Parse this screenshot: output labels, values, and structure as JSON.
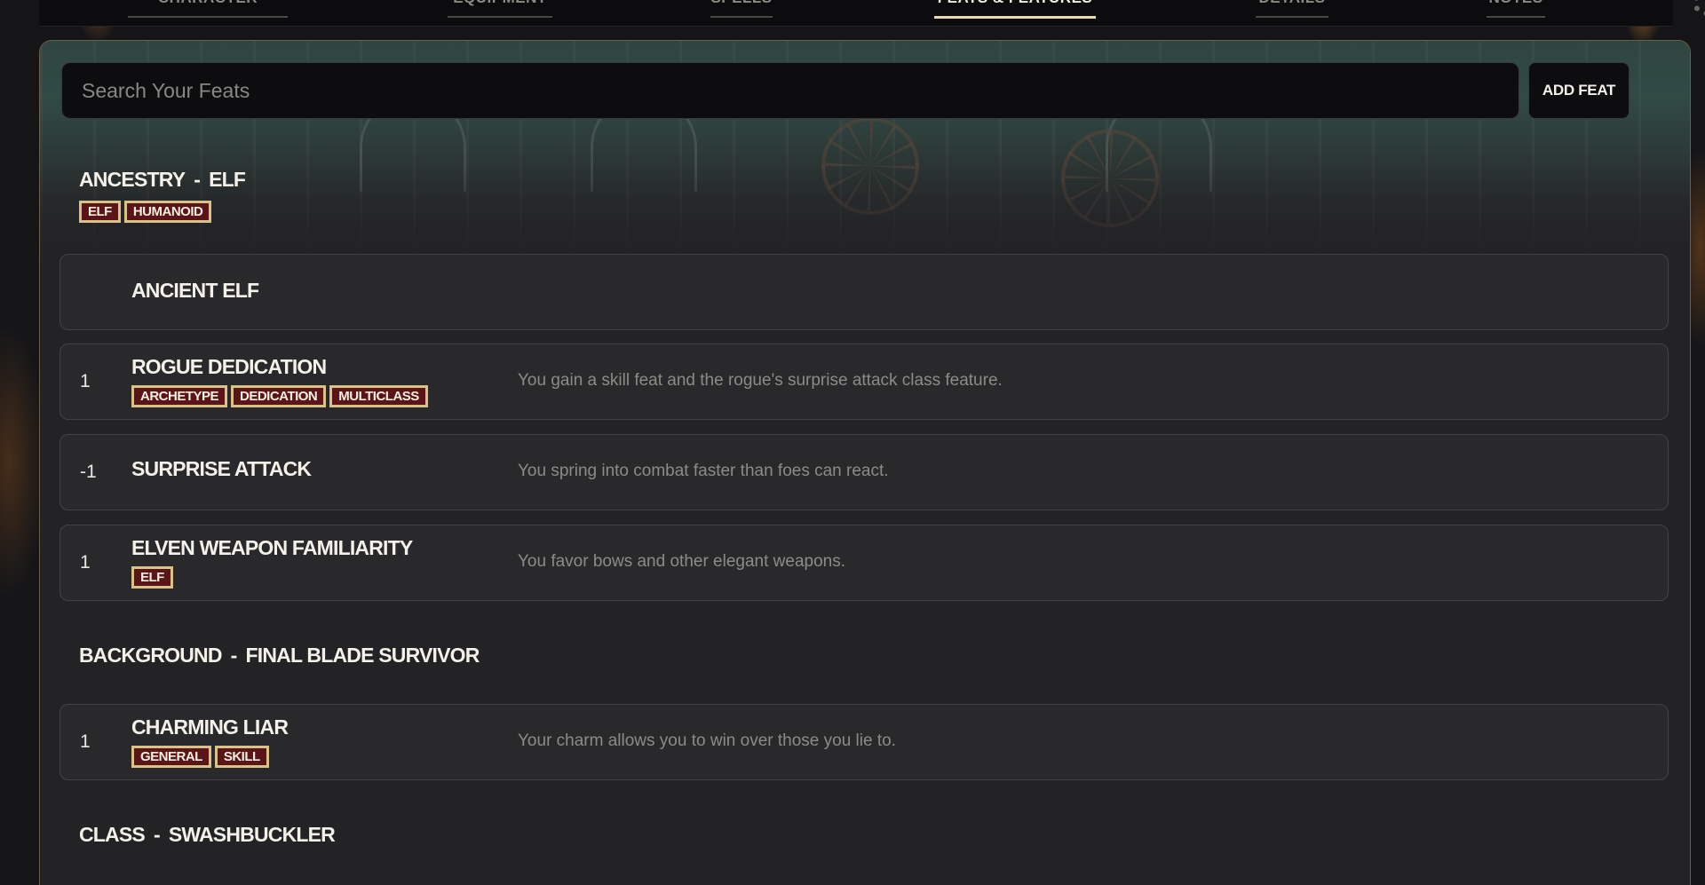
{
  "nav": {
    "tabs": [
      {
        "label": "CHARACTER"
      },
      {
        "label": "EQUIPMENT"
      },
      {
        "label": "SPELLS"
      },
      {
        "label": "FEATS & FEATURES",
        "active": true
      },
      {
        "label": "DETAILS"
      },
      {
        "label": "NOTES"
      }
    ]
  },
  "search": {
    "placeholder": "Search Your Feats",
    "value": ""
  },
  "add_feat_label": "ADD FEAT",
  "separator": "-",
  "sections": {
    "ancestry": {
      "label": "ANCESTRY",
      "value": "ELF",
      "tags": [
        "ELF",
        "HUMANOID"
      ]
    },
    "background": {
      "label": "BACKGROUND",
      "value": "FINAL BLADE SURVIVOR"
    },
    "class": {
      "label": "CLASS",
      "value": "SWASHBUCKLER"
    }
  },
  "feats": [
    {
      "level": "",
      "name": "ANCIENT ELF",
      "tags": [],
      "description": ""
    },
    {
      "level": "1",
      "name": "ROGUE DEDICATION",
      "tags": [
        "ARCHETYPE",
        "DEDICATION",
        "MULTICLASS"
      ],
      "description": "You gain a skill feat and the rogue's surprise attack class feature."
    },
    {
      "level": "-1",
      "name": "SURPRISE ATTACK",
      "tags": [],
      "description": "You spring into combat faster than foes can react."
    },
    {
      "level": "1",
      "name": "ELVEN WEAPON FAMILIARITY",
      "tags": [
        "ELF"
      ],
      "description": "You favor bows and other elegant weapons."
    },
    {
      "level": "1",
      "name": "CHARMING LIAR",
      "tags": [
        "GENERAL",
        "SKILL"
      ],
      "description": "Your charm allows you to win over those you lie to."
    }
  ],
  "colors": {
    "tag_fill": "#5b1418",
    "tag_border": "#d9c287",
    "panel_border": "#6d5f45",
    "active_tab_underline": "#e9d9b0"
  }
}
